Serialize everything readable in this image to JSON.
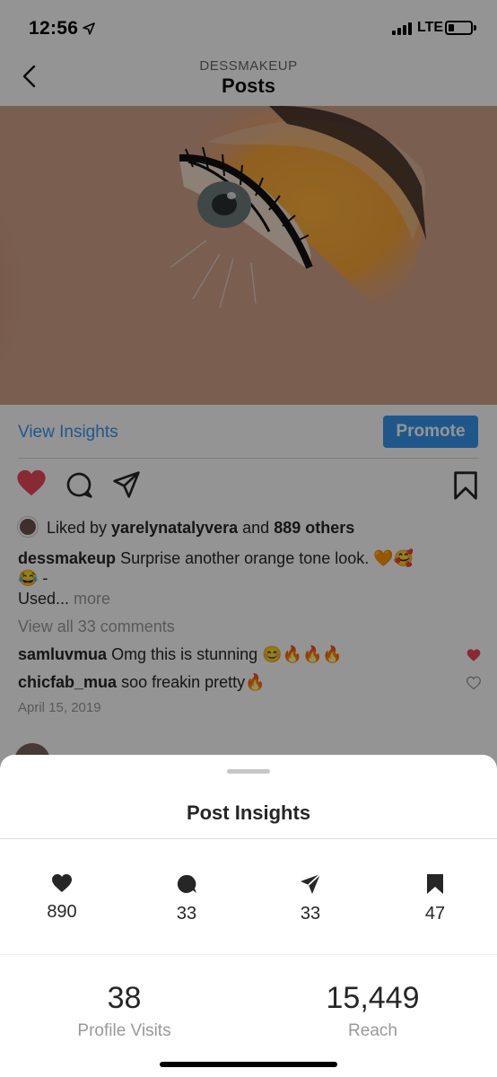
{
  "status": {
    "time": "12:56",
    "network": "LTE"
  },
  "nav": {
    "subtitle": "DESSMAKEUP",
    "title": "Posts"
  },
  "post": {
    "view_insights": "View Insights",
    "promote": "Promote",
    "liked_by_prefix": "Liked by ",
    "liked_by_user": "yarelynatalyvera",
    "liked_by_and": " and ",
    "liked_by_others": "889 others",
    "caption_user": "dessmakeup",
    "caption_text": "Surprise another orange tone look. 🧡🥰",
    "caption_line2": "😂 -",
    "caption_line3": "Used...",
    "more": "more",
    "view_all": "View all 33 comments",
    "comments": [
      {
        "user": "samluvmua",
        "text": "Omg this is stunning 😊🔥🔥🔥",
        "liked": true
      },
      {
        "user": "chicfab_mua",
        "text": "soo freakin pretty🔥",
        "liked": false
      }
    ],
    "date": "April 15, 2019"
  },
  "insights": {
    "title": "Post Insights",
    "metrics": [
      {
        "icon": "heart-icon",
        "value": "890"
      },
      {
        "icon": "comment-icon",
        "value": "33"
      },
      {
        "icon": "share-icon",
        "value": "33"
      },
      {
        "icon": "bookmark-icon",
        "value": "47"
      }
    ],
    "profile_visits": {
      "value": "38",
      "label": "Profile Visits"
    },
    "reach": {
      "value": "15,449",
      "label": "Reach"
    }
  },
  "colors": {
    "accent": "#3897f0",
    "like": "#ed4956",
    "dim_overlay": "rgba(0,0,0,0.42)"
  }
}
